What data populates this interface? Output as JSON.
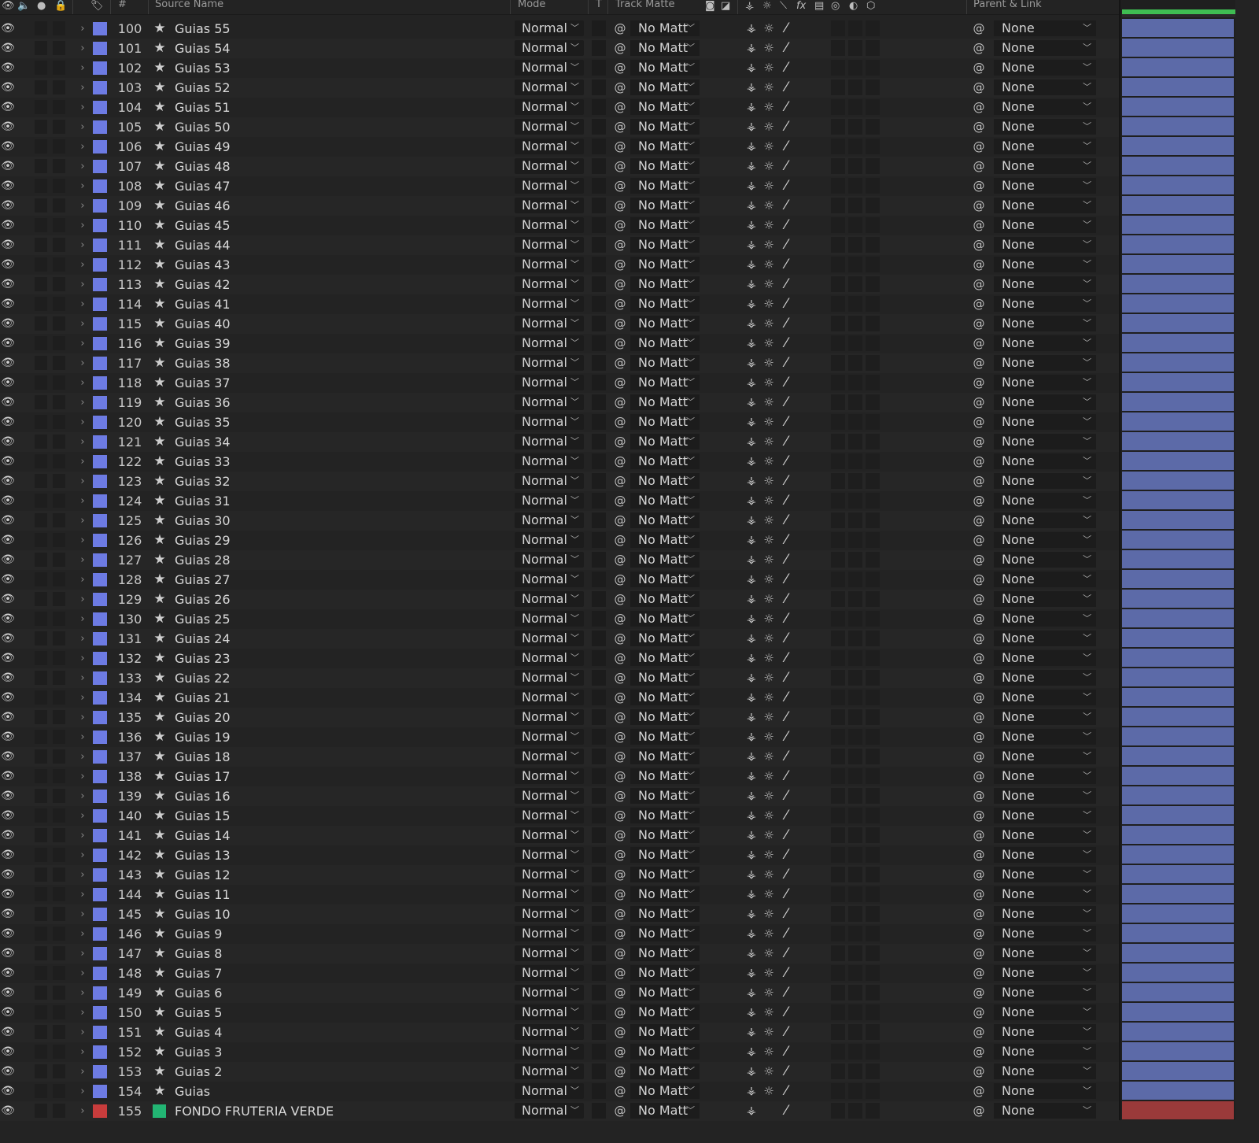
{
  "header": {
    "source_name": "Source Name",
    "hash": "#",
    "mode": "Mode",
    "t": "T",
    "track_matte": "Track Matte",
    "parent_link": "Parent & Link"
  },
  "colors": {
    "label_blue": "#6d7be3",
    "label_red": "#c83c3c",
    "bar_blue": "#5c6aa8",
    "bar_red": "#9a3a3a",
    "work_area_green": "#3fbd52"
  },
  "rows": [
    {
      "num": "100",
      "name": "Guias 55",
      "mode": "Normal",
      "matte": "No Matt",
      "parent": "None"
    },
    {
      "num": "101",
      "name": "Guias 54",
      "mode": "Normal",
      "matte": "No Matt",
      "parent": "None"
    },
    {
      "num": "102",
      "name": "Guias 53",
      "mode": "Normal",
      "matte": "No Matt",
      "parent": "None"
    },
    {
      "num": "103",
      "name": "Guias 52",
      "mode": "Normal",
      "matte": "No Matt",
      "parent": "None"
    },
    {
      "num": "104",
      "name": "Guias 51",
      "mode": "Normal",
      "matte": "No Matt",
      "parent": "None"
    },
    {
      "num": "105",
      "name": "Guias 50",
      "mode": "Normal",
      "matte": "No Matt",
      "parent": "None"
    },
    {
      "num": "106",
      "name": "Guias 49",
      "mode": "Normal",
      "matte": "No Matt",
      "parent": "None"
    },
    {
      "num": "107",
      "name": "Guias 48",
      "mode": "Normal",
      "matte": "No Matt",
      "parent": "None"
    },
    {
      "num": "108",
      "name": "Guias 47",
      "mode": "Normal",
      "matte": "No Matt",
      "parent": "None"
    },
    {
      "num": "109",
      "name": "Guias 46",
      "mode": "Normal",
      "matte": "No Matt",
      "parent": "None"
    },
    {
      "num": "110",
      "name": "Guias 45",
      "mode": "Normal",
      "matte": "No Matt",
      "parent": "None"
    },
    {
      "num": "111",
      "name": "Guias 44",
      "mode": "Normal",
      "matte": "No Matt",
      "parent": "None"
    },
    {
      "num": "112",
      "name": "Guias 43",
      "mode": "Normal",
      "matte": "No Matt",
      "parent": "None"
    },
    {
      "num": "113",
      "name": "Guias 42",
      "mode": "Normal",
      "matte": "No Matt",
      "parent": "None"
    },
    {
      "num": "114",
      "name": "Guias 41",
      "mode": "Normal",
      "matte": "No Matt",
      "parent": "None"
    },
    {
      "num": "115",
      "name": "Guias 40",
      "mode": "Normal",
      "matte": "No Matt",
      "parent": "None"
    },
    {
      "num": "116",
      "name": "Guias 39",
      "mode": "Normal",
      "matte": "No Matt",
      "parent": "None"
    },
    {
      "num": "117",
      "name": "Guias 38",
      "mode": "Normal",
      "matte": "No Matt",
      "parent": "None"
    },
    {
      "num": "118",
      "name": "Guias 37",
      "mode": "Normal",
      "matte": "No Matt",
      "parent": "None"
    },
    {
      "num": "119",
      "name": "Guias 36",
      "mode": "Normal",
      "matte": "No Matt",
      "parent": "None"
    },
    {
      "num": "120",
      "name": "Guias 35",
      "mode": "Normal",
      "matte": "No Matt",
      "parent": "None"
    },
    {
      "num": "121",
      "name": "Guias 34",
      "mode": "Normal",
      "matte": "No Matt",
      "parent": "None"
    },
    {
      "num": "122",
      "name": "Guias 33",
      "mode": "Normal",
      "matte": "No Matt",
      "parent": "None"
    },
    {
      "num": "123",
      "name": "Guias 32",
      "mode": "Normal",
      "matte": "No Matt",
      "parent": "None"
    },
    {
      "num": "124",
      "name": "Guias 31",
      "mode": "Normal",
      "matte": "No Matt",
      "parent": "None"
    },
    {
      "num": "125",
      "name": "Guias 30",
      "mode": "Normal",
      "matte": "No Matt",
      "parent": "None"
    },
    {
      "num": "126",
      "name": "Guias 29",
      "mode": "Normal",
      "matte": "No Matt",
      "parent": "None"
    },
    {
      "num": "127",
      "name": "Guias 28",
      "mode": "Normal",
      "matte": "No Matt",
      "parent": "None"
    },
    {
      "num": "128",
      "name": "Guias 27",
      "mode": "Normal",
      "matte": "No Matt",
      "parent": "None"
    },
    {
      "num": "129",
      "name": "Guias 26",
      "mode": "Normal",
      "matte": "No Matt",
      "parent": "None"
    },
    {
      "num": "130",
      "name": "Guias 25",
      "mode": "Normal",
      "matte": "No Matt",
      "parent": "None"
    },
    {
      "num": "131",
      "name": "Guias 24",
      "mode": "Normal",
      "matte": "No Matt",
      "parent": "None"
    },
    {
      "num": "132",
      "name": "Guias 23",
      "mode": "Normal",
      "matte": "No Matt",
      "parent": "None"
    },
    {
      "num": "133",
      "name": "Guias 22",
      "mode": "Normal",
      "matte": "No Matt",
      "parent": "None"
    },
    {
      "num": "134",
      "name": "Guias 21",
      "mode": "Normal",
      "matte": "No Matt",
      "parent": "None"
    },
    {
      "num": "135",
      "name": "Guias 20",
      "mode": "Normal",
      "matte": "No Matt",
      "parent": "None"
    },
    {
      "num": "136",
      "name": "Guias 19",
      "mode": "Normal",
      "matte": "No Matt",
      "parent": "None"
    },
    {
      "num": "137",
      "name": "Guias 18",
      "mode": "Normal",
      "matte": "No Matt",
      "parent": "None"
    },
    {
      "num": "138",
      "name": "Guias 17",
      "mode": "Normal",
      "matte": "No Matt",
      "parent": "None"
    },
    {
      "num": "139",
      "name": "Guias 16",
      "mode": "Normal",
      "matte": "No Matt",
      "parent": "None"
    },
    {
      "num": "140",
      "name": "Guias 15",
      "mode": "Normal",
      "matte": "No Matt",
      "parent": "None"
    },
    {
      "num": "141",
      "name": "Guias 14",
      "mode": "Normal",
      "matte": "No Matt",
      "parent": "None"
    },
    {
      "num": "142",
      "name": "Guias 13",
      "mode": "Normal",
      "matte": "No Matt",
      "parent": "None"
    },
    {
      "num": "143",
      "name": "Guias 12",
      "mode": "Normal",
      "matte": "No Matt",
      "parent": "None"
    },
    {
      "num": "144",
      "name": "Guias 11",
      "mode": "Normal",
      "matte": "No Matt",
      "parent": "None"
    },
    {
      "num": "145",
      "name": "Guias 10",
      "mode": "Normal",
      "matte": "No Matt",
      "parent": "None"
    },
    {
      "num": "146",
      "name": "Guias 9",
      "mode": "Normal",
      "matte": "No Matt",
      "parent": "None"
    },
    {
      "num": "147",
      "name": "Guias 8",
      "mode": "Normal",
      "matte": "No Matt",
      "parent": "None"
    },
    {
      "num": "148",
      "name": "Guias 7",
      "mode": "Normal",
      "matte": "No Matt",
      "parent": "None"
    },
    {
      "num": "149",
      "name": "Guias 6",
      "mode": "Normal",
      "matte": "No Matt",
      "parent": "None"
    },
    {
      "num": "150",
      "name": "Guias 5",
      "mode": "Normal",
      "matte": "No Matt",
      "parent": "None"
    },
    {
      "num": "151",
      "name": "Guias 4",
      "mode": "Normal",
      "matte": "No Matt",
      "parent": "None"
    },
    {
      "num": "152",
      "name": "Guias 3",
      "mode": "Normal",
      "matte": "No Matt",
      "parent": "None"
    },
    {
      "num": "153",
      "name": "Guias 2",
      "mode": "Normal",
      "matte": "No Matt",
      "parent": "None"
    },
    {
      "num": "154",
      "name": "Guias",
      "mode": "Normal",
      "matte": "No Matt",
      "parent": "None"
    },
    {
      "num": "155",
      "name": "FONDO FRUTERIA VERDE",
      "mode": "Normal",
      "matte": "No Matt",
      "parent": "None",
      "footage": true
    }
  ]
}
